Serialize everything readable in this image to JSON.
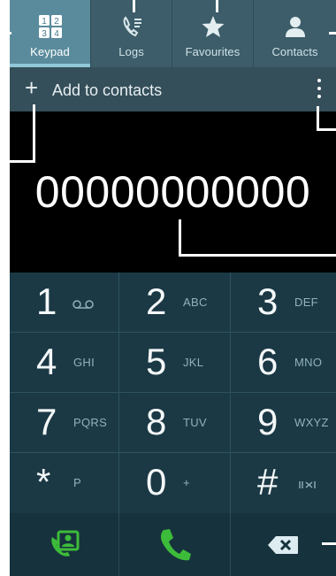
{
  "tabs": [
    {
      "label": "Keypad",
      "icon": "keypad-grid-icon",
      "active": true
    },
    {
      "label": "Logs",
      "icon": "call-log-icon",
      "active": false
    },
    {
      "label": "Favourites",
      "icon": "star-icon",
      "active": false
    },
    {
      "label": "Contacts",
      "icon": "person-icon",
      "active": false
    }
  ],
  "add_bar": {
    "plus": "+",
    "label": "Add to contacts"
  },
  "display": {
    "number": "00000000000"
  },
  "keys": [
    {
      "digit": "1",
      "letters": ""
    },
    {
      "digit": "2",
      "letters": "ABC"
    },
    {
      "digit": "3",
      "letters": "DEF"
    },
    {
      "digit": "4",
      "letters": "GHI"
    },
    {
      "digit": "5",
      "letters": "JKL"
    },
    {
      "digit": "6",
      "letters": "MNO"
    },
    {
      "digit": "7",
      "letters": "PQRS"
    },
    {
      "digit": "8",
      "letters": "TUV"
    },
    {
      "digit": "9",
      "letters": "WXYZ"
    },
    {
      "digit": "*",
      "letters": "P"
    },
    {
      "digit": "0",
      "letters": "+"
    },
    {
      "digit": "#",
      "letters": ""
    }
  ],
  "actions": [
    {
      "icon": "contact-call-icon"
    },
    {
      "icon": "phone-call-icon"
    },
    {
      "icon": "backspace-icon"
    }
  ],
  "colors": {
    "tab_active": "#5a8b9c",
    "keypad_bg": "#1b3945",
    "call_green": "#3dbb3a"
  }
}
